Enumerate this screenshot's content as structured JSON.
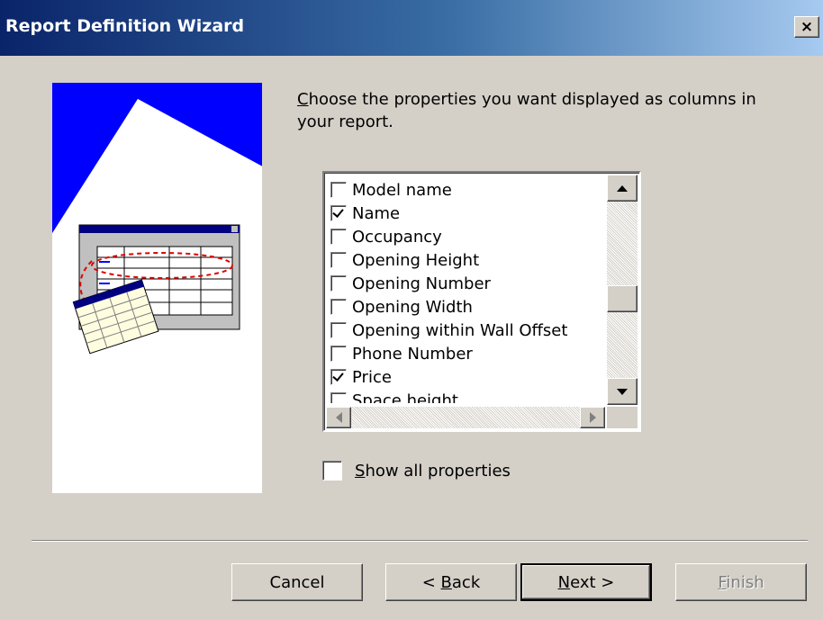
{
  "window": {
    "title": "Report Definition Wizard",
    "close_glyph": "×"
  },
  "instruction": {
    "text": "Choose the properties you want displayed as columns in your report.",
    "access_key": "C"
  },
  "properties": [
    {
      "label": "Model name",
      "checked": false
    },
    {
      "label": "Name",
      "checked": true
    },
    {
      "label": "Occupancy",
      "checked": false
    },
    {
      "label": "Opening Height",
      "checked": false
    },
    {
      "label": "Opening Number",
      "checked": false
    },
    {
      "label": "Opening Width",
      "checked": false
    },
    {
      "label": "Opening within Wall Offset",
      "checked": false
    },
    {
      "label": "Phone Number",
      "checked": false
    },
    {
      "label": "Price",
      "checked": true
    },
    {
      "label": "Space height",
      "checked": false
    }
  ],
  "show_all": {
    "label": "Show all properties",
    "access_key": "S",
    "checked": false
  },
  "buttons": [
    {
      "label": "Cancel",
      "access_key": "",
      "state": "normal"
    },
    {
      "label": "< Back",
      "access_key": "B",
      "state": "normal"
    },
    {
      "label": "Next >",
      "access_key": "N",
      "state": "default"
    },
    {
      "label": "Finish",
      "access_key": "F",
      "state": "disabled"
    }
  ],
  "colors": {
    "title_start": "#0a246a",
    "title_end": "#a6caf0",
    "panel_blue": "#0000ff",
    "face": "#d4d0c8"
  }
}
